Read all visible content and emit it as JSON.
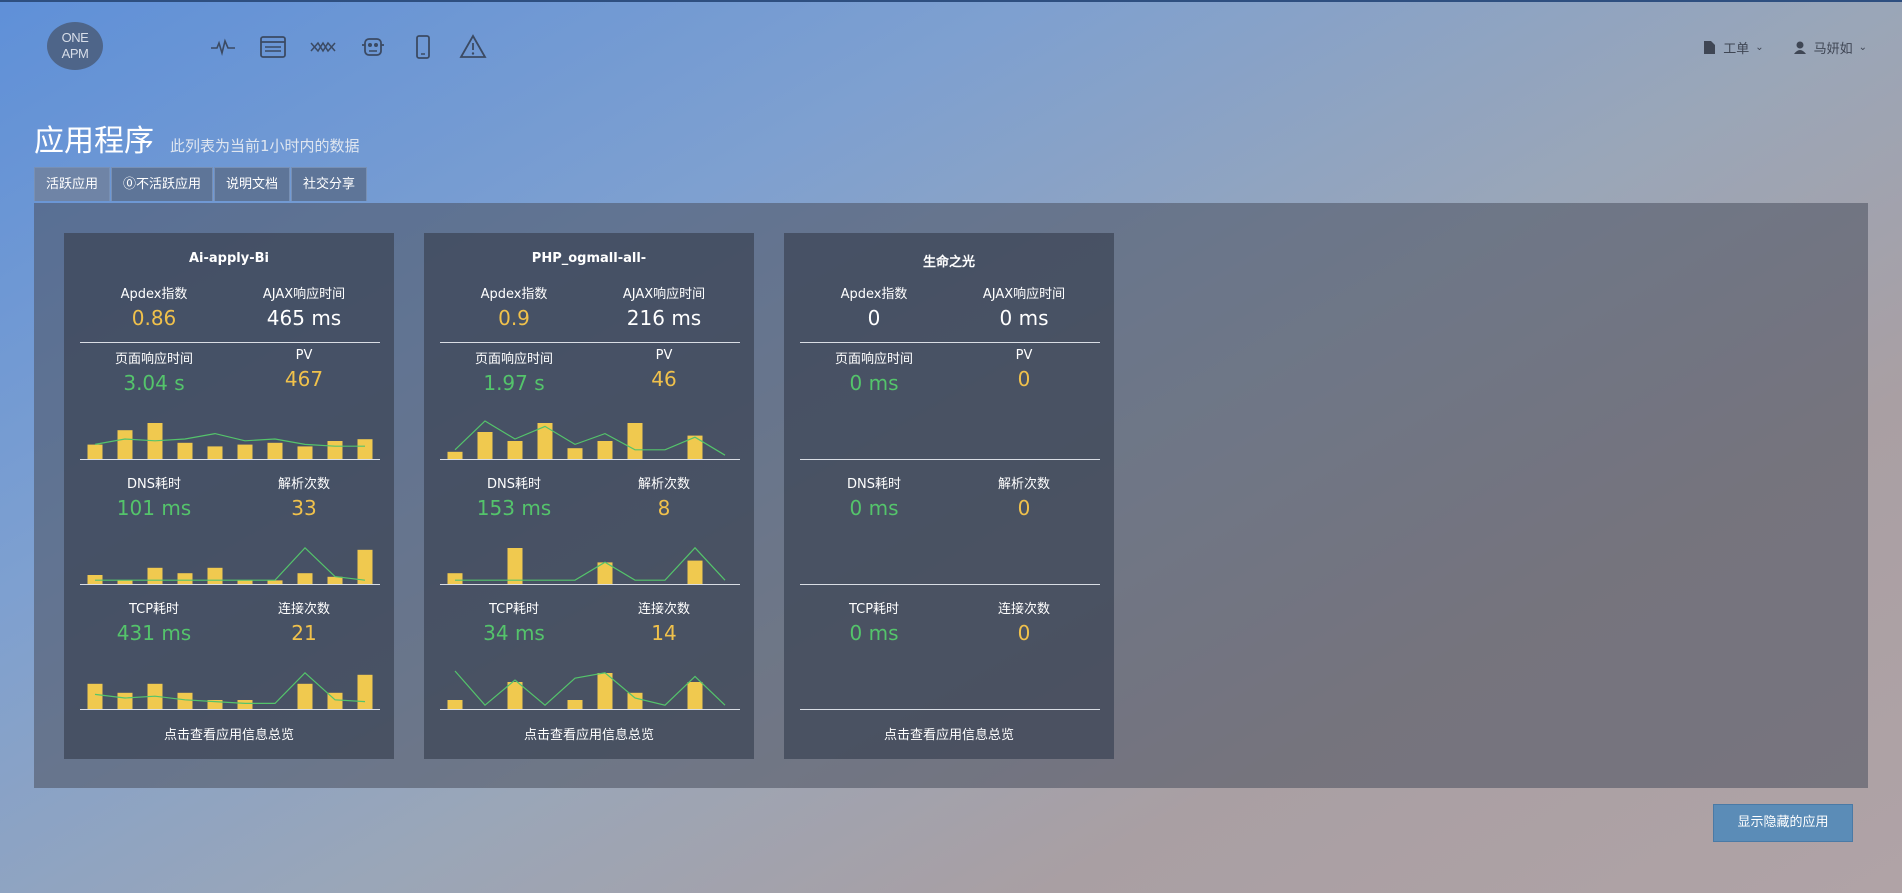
{
  "app": {
    "logo_text_top": "ONE",
    "logo_text_bottom": "APM",
    "nav_icons": [
      "pulse-icon",
      "browser-icon",
      "topology-icon",
      "robot-icon",
      "mobile-icon",
      "alert-icon"
    ],
    "ticket_label": "工单",
    "user_name": "马妍如"
  },
  "page": {
    "title": "应用程序",
    "subtitle": "此列表为当前1小时内的数据"
  },
  "tabs": [
    {
      "label": "活跃应用",
      "active": true
    },
    {
      "label": "⓪不活跃应用",
      "active": false
    },
    {
      "label": "说明文档",
      "active": false
    },
    {
      "label": "社交分享",
      "active": false
    }
  ],
  "cards": [
    {
      "name": "Ai-apply-Bi",
      "apdex_label": "Apdex指数",
      "apdex": "0.86",
      "ajax_label": "AJAX响应时间",
      "ajax": "465 ms",
      "page_label": "页面响应时间",
      "page_time": "3.04 s",
      "pv_label": "PV",
      "pv": "467",
      "dns_label": "DNS耗时",
      "dns": "101 ms",
      "parse_label": "解析次数",
      "parse": "33",
      "tcp_label": "TCP耗时",
      "tcp": "431 ms",
      "conn_label": "连接次数",
      "conn": "21",
      "link": "点击查看应用信息总览",
      "spark1": {
        "bars": [
          0.4,
          0.8,
          1.0,
          0.45,
          0.35,
          0.4,
          0.45,
          0.35,
          0.5,
          0.55
        ],
        "line": [
          0.35,
          0.5,
          0.45,
          0.5,
          0.65,
          0.45,
          0.5,
          0.35,
          0.3,
          0.3
        ]
      },
      "spark2": {
        "bars": [
          0.25,
          0.1,
          0.45,
          0.3,
          0.45,
          0.1,
          0.1,
          0.3,
          0.2,
          0.95
        ],
        "line": [
          0.05,
          0.05,
          0.05,
          0.05,
          0.05,
          0.05,
          0.05,
          0.95,
          0.15,
          0.05
        ]
      },
      "spark3": {
        "bars": [
          0.7,
          0.45,
          0.7,
          0.45,
          0.25,
          0.25,
          0.0,
          0.7,
          0.45,
          0.95
        ],
        "line": [
          0.35,
          0.25,
          0.3,
          0.2,
          0.15,
          0.1,
          0.1,
          0.95,
          0.2,
          0.15
        ]
      }
    },
    {
      "name": "PHP_ogmall-all-",
      "apdex_label": "Apdex指数",
      "apdex": "0.9",
      "ajax_label": "AJAX响应时间",
      "ajax": "216 ms",
      "page_label": "页面响应时间",
      "page_time": "1.97 s",
      "pv_label": "PV",
      "pv": "46",
      "dns_label": "DNS耗时",
      "dns": "153 ms",
      "parse_label": "解析次数",
      "parse": "8",
      "tcp_label": "TCP耗时",
      "tcp": "34 ms",
      "conn_label": "连接次数",
      "conn": "14",
      "link": "点击查看应用信息总览",
      "spark1": {
        "bars": [
          0.2,
          0.75,
          0.5,
          1.0,
          0.3,
          0.5,
          1.0,
          0.0,
          0.65,
          0.0
        ],
        "line": [
          0.2,
          1.0,
          0.5,
          0.85,
          0.35,
          0.65,
          0.2,
          0.2,
          0.55,
          0.05
        ]
      },
      "spark2": {
        "bars": [
          0.3,
          0.0,
          1.0,
          0.0,
          0.0,
          0.6,
          0.0,
          0.0,
          0.65,
          0.0
        ],
        "line": [
          0.05,
          0.05,
          0.05,
          0.05,
          0.05,
          0.55,
          0.05,
          0.05,
          0.95,
          0.05
        ]
      },
      "spark3": {
        "bars": [
          0.25,
          0.0,
          0.75,
          0.0,
          0.25,
          1.0,
          0.45,
          0.0,
          0.75,
          0.0
        ],
        "line": [
          1.0,
          0.05,
          0.75,
          0.05,
          0.8,
          0.95,
          0.25,
          0.05,
          0.85,
          0.05
        ]
      }
    },
    {
      "name": "生命之光",
      "apdex_label": "Apdex指数",
      "apdex": "0",
      "ajax_label": "AJAX响应时间",
      "ajax": "0 ms",
      "page_label": "页面响应时间",
      "page_time": "0 ms",
      "pv_label": "PV",
      "pv": "0",
      "dns_label": "DNS耗时",
      "dns": "0 ms",
      "parse_label": "解析次数",
      "parse": "0",
      "tcp_label": "TCP耗时",
      "tcp": "0 ms",
      "conn_label": "连接次数",
      "conn": "0",
      "link": "点击查看应用信息总览",
      "spark1": {
        "bars": [],
        "line": []
      },
      "spark2": {
        "bars": [],
        "line": []
      },
      "spark3": {
        "bars": [],
        "line": []
      }
    }
  ],
  "show_hidden_label": "显示隐藏的应用",
  "colors": {
    "bar": "#f0c94f",
    "line": "#54c46b",
    "apdex": "#f0c14b",
    "good": "#54c46b"
  }
}
